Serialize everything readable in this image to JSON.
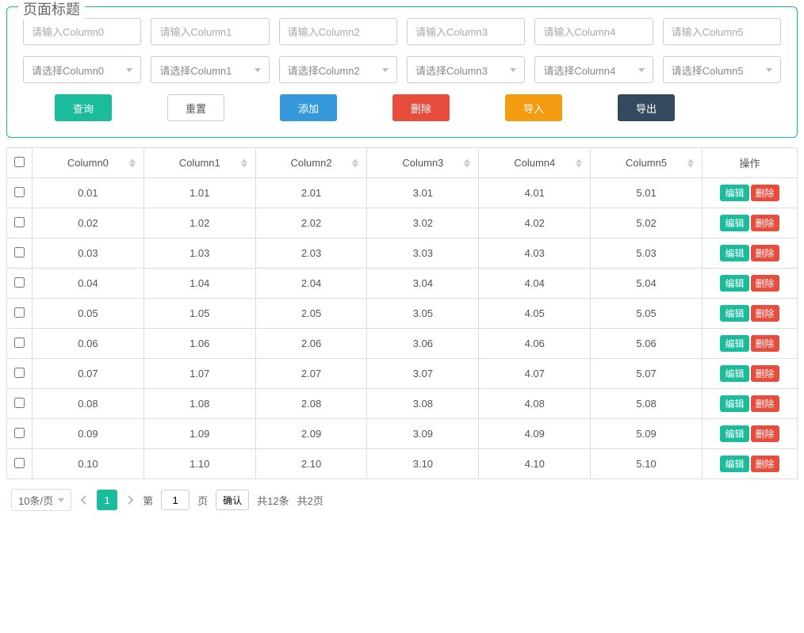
{
  "page_title": "页面标题",
  "inputs": [
    {
      "placeholder": "请输入Column0"
    },
    {
      "placeholder": "请输入Column1"
    },
    {
      "placeholder": "请输入Column2"
    },
    {
      "placeholder": "请输入Column3"
    },
    {
      "placeholder": "请输入Column4"
    },
    {
      "placeholder": "请输入Column5"
    }
  ],
  "selects": [
    {
      "label": "请选择Column0"
    },
    {
      "label": "请选择Column1"
    },
    {
      "label": "请选择Column2"
    },
    {
      "label": "请选择Column3"
    },
    {
      "label": "请选择Column4"
    },
    {
      "label": "请选择Column5"
    }
  ],
  "toolbar": {
    "query": "查询",
    "reset": "重置",
    "add": "添加",
    "delete": "删除",
    "import": "导入",
    "export": "导出"
  },
  "table": {
    "headers": [
      "Column0",
      "Column1",
      "Column2",
      "Column3",
      "Column4",
      "Column5"
    ],
    "action_header": "操作",
    "edit_label": "编辑",
    "delete_label": "删除",
    "rows": [
      [
        "0.01",
        "1.01",
        "2.01",
        "3.01",
        "4.01",
        "5.01"
      ],
      [
        "0.02",
        "1.02",
        "2.02",
        "3.02",
        "4.02",
        "5.02"
      ],
      [
        "0.03",
        "1.03",
        "2.03",
        "3.03",
        "4.03",
        "5.03"
      ],
      [
        "0.04",
        "1.04",
        "2.04",
        "3.04",
        "4.04",
        "5.04"
      ],
      [
        "0.05",
        "1.05",
        "2.05",
        "3.05",
        "4.05",
        "5.05"
      ],
      [
        "0.06",
        "1.06",
        "2.06",
        "3.06",
        "4.06",
        "5.06"
      ],
      [
        "0.07",
        "1.07",
        "2.07",
        "3.07",
        "4.07",
        "5.07"
      ],
      [
        "0.08",
        "1.08",
        "2.08",
        "3.08",
        "4.08",
        "5.08"
      ],
      [
        "0.09",
        "1.09",
        "2.09",
        "3.09",
        "4.09",
        "5.09"
      ],
      [
        "0.10",
        "1.10",
        "2.10",
        "3.10",
        "4.10",
        "5.10"
      ]
    ]
  },
  "pager": {
    "page_size": "10条/页",
    "current_page": "1",
    "page_label_before": "第",
    "page_input": "1",
    "page_label_after": "页",
    "confirm": "确认",
    "total": "共12条",
    "pages": "共2页"
  }
}
